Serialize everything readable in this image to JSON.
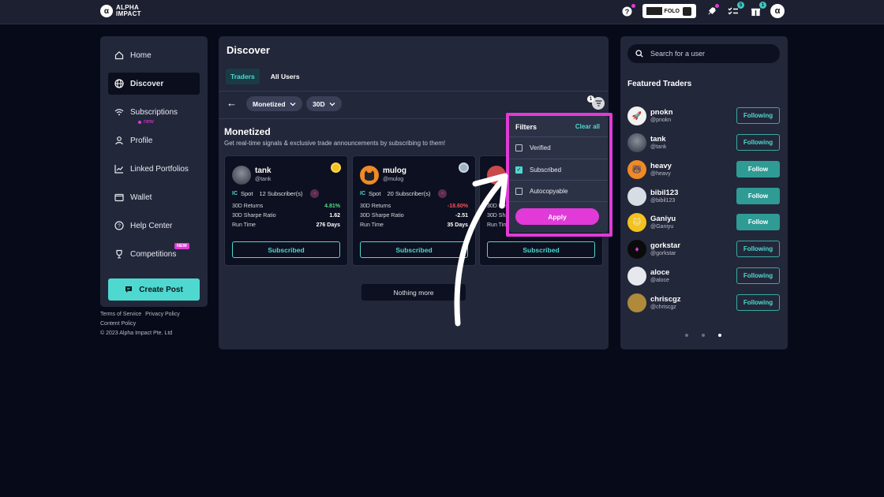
{
  "brand": {
    "mark": "α",
    "line1": "ALPHA",
    "line2": "IMPACT"
  },
  "topbar": {
    "folo_label": "FOLO",
    "notif_count_1": "5",
    "notif_count_2": "1",
    "avatar": "α"
  },
  "sidebar": {
    "items": [
      {
        "label": "Home",
        "icon": "home-icon"
      },
      {
        "label": "Discover",
        "icon": "globe-icon"
      },
      {
        "label": "Subscriptions",
        "icon": "wifi-icon",
        "sub": "new"
      },
      {
        "label": "Profile",
        "icon": "user-icon"
      },
      {
        "label": "Linked Portfolios",
        "icon": "chart-icon"
      },
      {
        "label": "Wallet",
        "icon": "wallet-icon"
      },
      {
        "label": "Help Center",
        "icon": "help-icon"
      },
      {
        "label": "Competitions",
        "icon": "trophy-icon",
        "badge": "NEW"
      }
    ],
    "create_post": "Create Post"
  },
  "footer": {
    "terms": "Terms of Service",
    "privacy": "Privacy Policy",
    "content": "Content Policy",
    "copyright": "© 2023 Alpha Impact Pte. Ltd"
  },
  "main": {
    "title": "Discover",
    "tabs": [
      "Traders",
      "All Users"
    ],
    "pills": [
      "Monetized",
      "30D"
    ],
    "filter_count": "1",
    "section_title": "Monetized",
    "section_sub": "Get real-time signals & exclusive trade announcements by subscribing to them!",
    "cards": [
      {
        "name": "tank",
        "handle": "@tank",
        "market": "Spot",
        "subscribers": "12 Subscriber(s)",
        "returns_label": "30D Returns",
        "returns": "4.81%",
        "sharpe_label": "30D Sharpe Ratio",
        "sharpe": "1.62",
        "run_label": "Run Time",
        "run": "276 Days",
        "button": "Subscribed"
      },
      {
        "name": "mulog",
        "handle": "@mulog",
        "market": "Spot",
        "subscribers": "20 Subscriber(s)",
        "returns_label": "30D Returns",
        "returns": "-18.60%",
        "sharpe_label": "30D Sharpe Ratio",
        "sharpe": "-2.51",
        "run_label": "Run Time",
        "run": "35 Days",
        "button": "Subscribed"
      },
      {
        "name": "",
        "handle": "",
        "market": "",
        "subscribers": "",
        "returns_label": "30D Re",
        "returns": "",
        "sharpe_label": "30D Sha",
        "sharpe": "",
        "run_label": "Run Tim",
        "run": "",
        "button": "Subscribed"
      }
    ],
    "nothing_more": "Nothing more"
  },
  "filters": {
    "title": "Filters",
    "clear": "Clear all",
    "options": [
      {
        "label": "Verified",
        "checked": false
      },
      {
        "label": "Subscribed",
        "checked": true
      },
      {
        "label": "Autocopyable",
        "checked": false
      }
    ],
    "apply": "Apply"
  },
  "right": {
    "search_placeholder": "Search for a user",
    "featured_title": "Featured Traders",
    "traders": [
      {
        "name": "pnokn",
        "handle": "@pnokn",
        "action": "Following"
      },
      {
        "name": "tank",
        "handle": "@tank",
        "action": "Following"
      },
      {
        "name": "heavy",
        "handle": "@heavy",
        "action": "Follow"
      },
      {
        "name": "bibil123",
        "handle": "@bibil123",
        "action": "Follow"
      },
      {
        "name": "Ganiyu",
        "handle": "@Ganiyu",
        "action": "Follow"
      },
      {
        "name": "gorkstar",
        "handle": "@gorkstar",
        "action": "Following"
      },
      {
        "name": "aloce",
        "handle": "@aloce",
        "action": "Following"
      },
      {
        "name": "chriscgz",
        "handle": "@chriscgz",
        "action": "Following"
      }
    ]
  },
  "colors": {
    "accent": "#4fd8d0",
    "highlight": "#e13ad8",
    "panel": "#23273a",
    "bg": "#070a18"
  }
}
